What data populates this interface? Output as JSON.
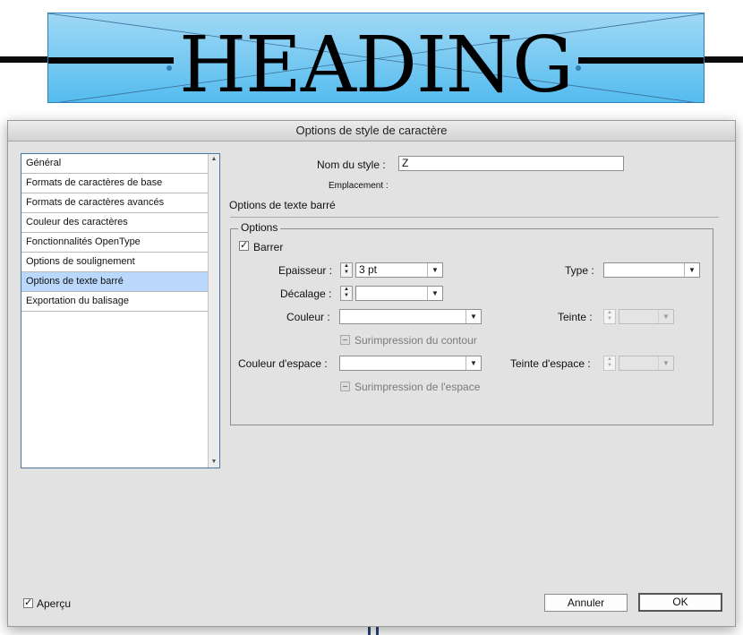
{
  "canvas": {
    "heading": "HEADING"
  },
  "dialog": {
    "title": "Options de style de caractère",
    "categories": [
      "Général",
      "Formats de caractères de base",
      "Formats de caractères avancés",
      "Couleur des caractères",
      "Fonctionnalités OpenType",
      "Options de soulignement",
      "Options de texte barré",
      "Exportation du balisage"
    ],
    "selected_category": "Options de texte barré",
    "style_name_label": "Nom du style :",
    "style_name_value": "Z",
    "location_label": "Emplacement :",
    "section_title": "Options de texte barré",
    "options_group": {
      "title": "Options",
      "strike_label": "Barrer",
      "strike_checked": true,
      "weight_label": "Epaisseur :",
      "weight_value": "3 pt",
      "type_label": "Type :",
      "type_value": "",
      "offset_label": "Décalage :",
      "offset_value": "",
      "color_label": "Couleur :",
      "color_value": "",
      "tint_label": "Teinte :",
      "tint_value": "",
      "overprint_stroke_label": "Surimpression du contour",
      "gap_color_label": "Couleur d'espace :",
      "gap_color_value": "",
      "gap_tint_label": "Teinte d'espace :",
      "gap_tint_value": "",
      "overprint_gap_label": "Surimpression de l'espace"
    },
    "preview_label": "Aperçu",
    "preview_checked": true,
    "cancel_label": "Annuler",
    "ok_label": "OK"
  }
}
